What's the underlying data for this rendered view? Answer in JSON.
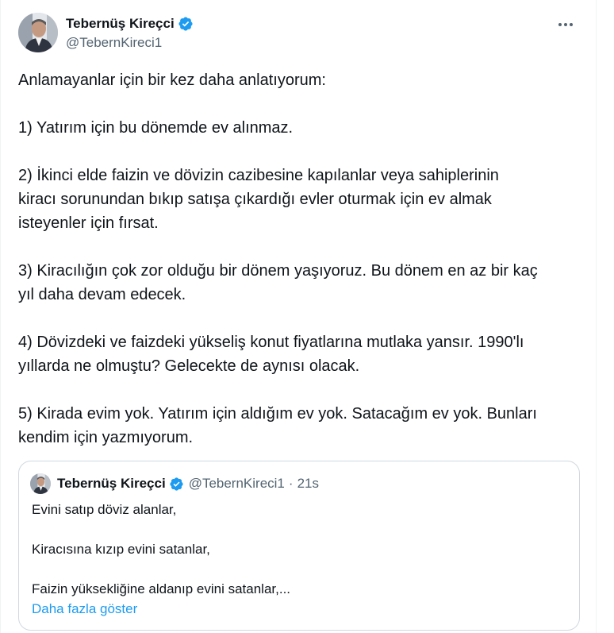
{
  "tweet": {
    "author_name": "Tebernüş Kireçci",
    "author_handle": "@TebernKireci1",
    "more_icon": "more-horizontal-icon",
    "verified_icon": "verified-badge-icon",
    "verified_color": "#1d9bf0",
    "text": "Anlamayanlar için bir kez daha anlatıyorum:\n\n1) Yatırım için bu dönemde ev alınmaz.\n\n2) İkinci elde faizin ve dövizin cazibesine kapılanlar veya sahiplerinin\nkiracı sorunundan bıkıp satışa çıkardığı evler oturmak için ev almak\nisteyenler için fırsat.\n\n3) Kiracılığın çok zor olduğu bir dönem yaşıyoruz. Bu dönem en az bir kaç\nyıl daha devam edecek.\n\n4) Dövizdeki ve faizdeki yükseliş konut fiyatlarına mutlaka yansır. 1990'lı\nyıllarda ne olmuştu? Gelecekte de aynısı olacak.\n\n5) Kirada evim yok. Yatırım için aldığım ev yok. Satacağım ev yok. Bunları\nkendim için yazmıyorum."
  },
  "quoted_tweet": {
    "author_name": "Tebernüş Kireçci",
    "author_handle": "@TebernKireci1",
    "separator": "·",
    "time": "21s",
    "text": "Evini satıp döviz alanlar,\n\nKiracısına kızıp evini satanlar,\n\nFaizin yüksekliğine aldanıp evini satanlar,...",
    "show_more_label": "Daha fazla göster",
    "link_color": "#1d9bf0"
  }
}
